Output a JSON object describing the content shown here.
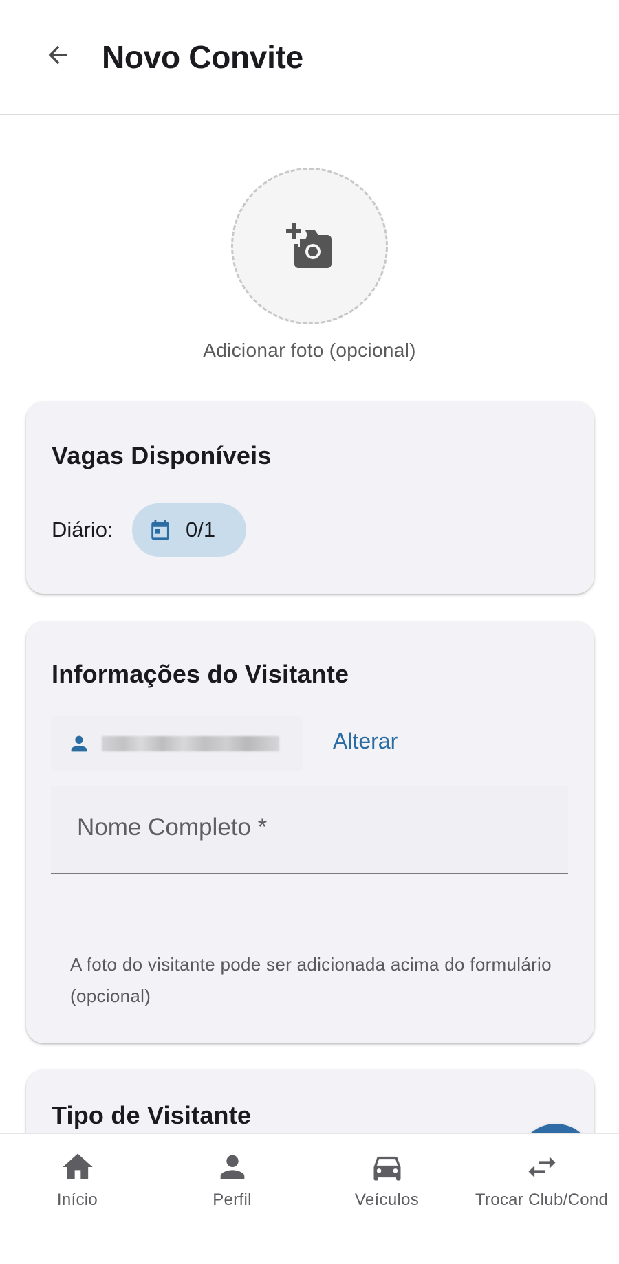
{
  "header": {
    "title": "Novo Convite",
    "back_icon": "arrow-back-icon"
  },
  "photo": {
    "caption": "Adicionar foto (opcional)",
    "icon": "add-camera-icon"
  },
  "vagas": {
    "title": "Vagas Disponíveis",
    "quota_label": "Diário:",
    "quota_value": "0/1",
    "chip_icon": "calendar-icon",
    "chip_color": "#c9dcec"
  },
  "visitor": {
    "title": "Informações do Visitante",
    "contact_icon": "person-icon",
    "change_label": "Alterar",
    "name_placeholder": "Nome Completo *",
    "name_value": "",
    "helper": "A foto do visitante pode ser adicionada acima do formulário (opcional)"
  },
  "tipo": {
    "title": "Tipo de Visitante"
  },
  "fab": {
    "icon": "help-icon",
    "color": "#2f6ca6"
  },
  "nav": {
    "items": [
      {
        "label": "Início",
        "icon": "home-icon"
      },
      {
        "label": "Perfil",
        "icon": "profile-icon"
      },
      {
        "label": "Veículos",
        "icon": "car-icon"
      },
      {
        "label": "Trocar Club/Cond",
        "icon": "swap-icon"
      }
    ]
  },
  "colors": {
    "accent": "#2b6ca3",
    "card_bg": "#f3f2f6"
  }
}
